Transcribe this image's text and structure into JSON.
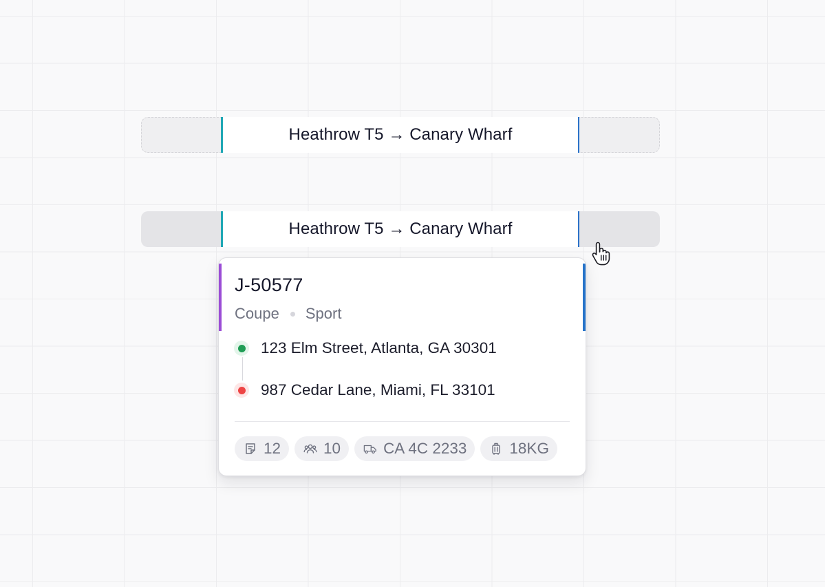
{
  "timeline": {
    "ghost_booking": {
      "label": "Heathrow T5 → Canary Wharf"
    },
    "active_booking": {
      "label": "Heathrow T5 → Canary Wharf"
    }
  },
  "popover": {
    "job_id": "J-50577",
    "vehicle_type": "Coupe",
    "vehicle_class": "Sport",
    "route": {
      "pickup": "123 Elm Street, Atlanta, GA 30301",
      "dropoff": "987 Cedar Lane, Miami, FL 33101"
    },
    "chips": [
      {
        "icon": "notes-icon",
        "value": "12"
      },
      {
        "icon": "passengers-icon",
        "value": "10"
      },
      {
        "icon": "truck-icon",
        "value": "CA 4C 2233"
      },
      {
        "icon": "luggage-icon",
        "value": "18KG"
      }
    ]
  },
  "colors": {
    "bar_left_accent": "#1fa7b5",
    "bar_right_accent": "#2b72c9",
    "card_left_accent": "#9b4dd6",
    "card_right_accent": "#2673c9",
    "pickup_dot": "#1f9d55",
    "dropoff_dot": "#ee4444"
  }
}
